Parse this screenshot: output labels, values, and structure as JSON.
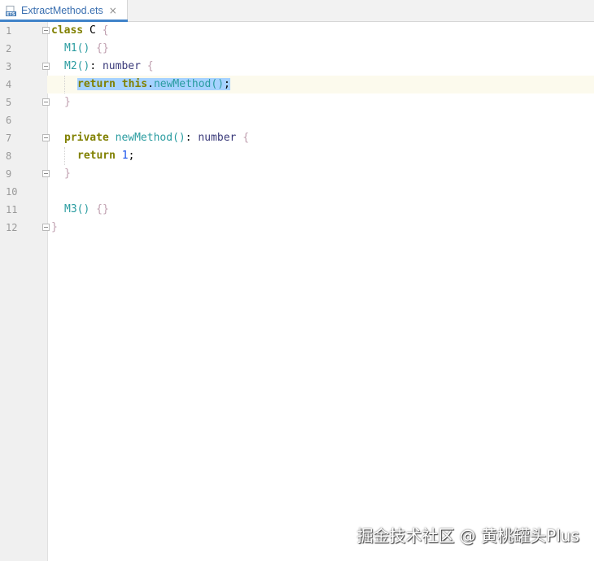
{
  "tab": {
    "file_name": "ExtractMethod.ets",
    "close_glyph": "×",
    "icon": "ets-file-icon"
  },
  "gutter": {
    "line_numbers": [
      "1",
      "2",
      "3",
      "4",
      "5",
      "6",
      "7",
      "8",
      "9",
      "10",
      "11",
      "12"
    ]
  },
  "code": {
    "l1_kw": "class",
    "l1_name": " C ",
    "l1_brace": "{",
    "l2_fn": "M1",
    "l2_paren": "()",
    "l2_sp": " ",
    "l2_braces": "{}",
    "l3_fn": "M2",
    "l3_paren": "()",
    "l3_colon": ": ",
    "l3_type": "number",
    "l3_sp": " ",
    "l3_brace": "{",
    "l4_ret": "return",
    "l4_sp": " ",
    "l4_this": "this",
    "l4_dot": ".",
    "l4_fn": "newMethod",
    "l4_paren": "()",
    "l4_semi": ";",
    "l5_brace": "}",
    "l7_kw": "private",
    "l7_sp": " ",
    "l7_fn": "newMethod",
    "l7_paren": "()",
    "l7_colon": ": ",
    "l7_type": "number",
    "l7_sp2": " ",
    "l7_brace": "{",
    "l8_ret": "return",
    "l8_sp": " ",
    "l8_num": "1",
    "l8_semi": ";",
    "l9_brace": "}",
    "l11_fn": "M3",
    "l11_paren": "()",
    "l11_sp": " ",
    "l11_braces": "{}",
    "l12_brace": "}"
  },
  "colors": {
    "keyword": "#808000",
    "function": "#2a9ca0",
    "selection": "#a6d2ff",
    "caret_row": "#fcfaed",
    "tab_accent": "#4083c9"
  },
  "watermark": "掘金技术社区 @ 黄桃罐头Plus"
}
